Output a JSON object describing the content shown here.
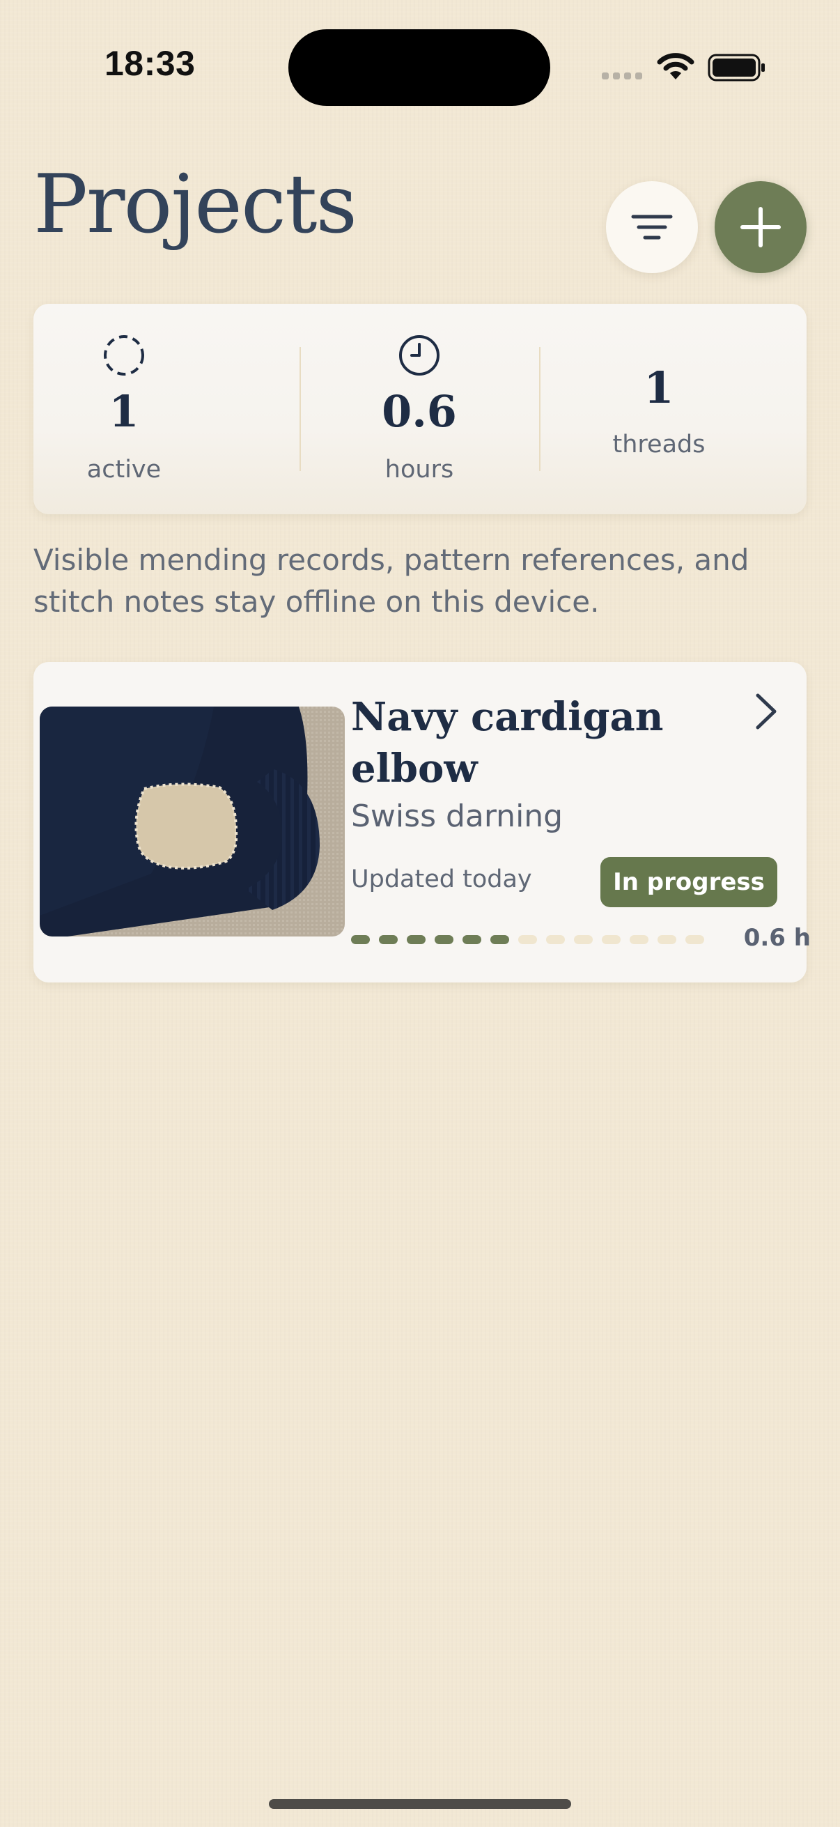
{
  "status_bar": {
    "time": "18:33"
  },
  "header": {
    "title": "Projects"
  },
  "stats": [
    {
      "icon": "dashed-circle-icon",
      "value": "1",
      "label": "active"
    },
    {
      "icon": "clock-icon",
      "value": "0.6",
      "label": "hours"
    },
    {
      "icon": "",
      "value": "1",
      "label": "threads"
    }
  ],
  "description": "Visible mending records, pattern references, and stitch notes stay offline on this device.",
  "projects": [
    {
      "title": "Navy cardigan elbow",
      "technique": "Swiss darning",
      "updated": "Updated today",
      "status": "In progress",
      "hours_label": "0.6 h",
      "progress_segments_filled": 6,
      "progress_segments_total": 13
    }
  ],
  "colors": {
    "accent": "#6e7d56",
    "badge": "#66784d",
    "background": "#f2e8d4",
    "card": "#f8f6f3",
    "title_text": "#33435a",
    "progress_empty": "#f0e6cf"
  }
}
